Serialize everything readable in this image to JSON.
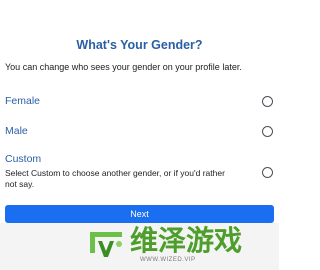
{
  "header": {
    "title": "What's Your Gender?",
    "subtitle": "You can change who sees your gender on your profile later."
  },
  "options": [
    {
      "label": "Female",
      "selected": false
    },
    {
      "label": "Male",
      "selected": false
    },
    {
      "label": "Custom",
      "description": "Select Custom to choose another gender, or if you'd rather not say.",
      "selected": false
    }
  ],
  "actions": {
    "next_label": "Next"
  },
  "watermark": {
    "text": "维泽游戏",
    "subtext": "WWW.WIZED.VIP"
  },
  "colors": {
    "accent": "#2a5fa4",
    "button": "#1a6ef0",
    "watermark": "#4d9e2a"
  }
}
